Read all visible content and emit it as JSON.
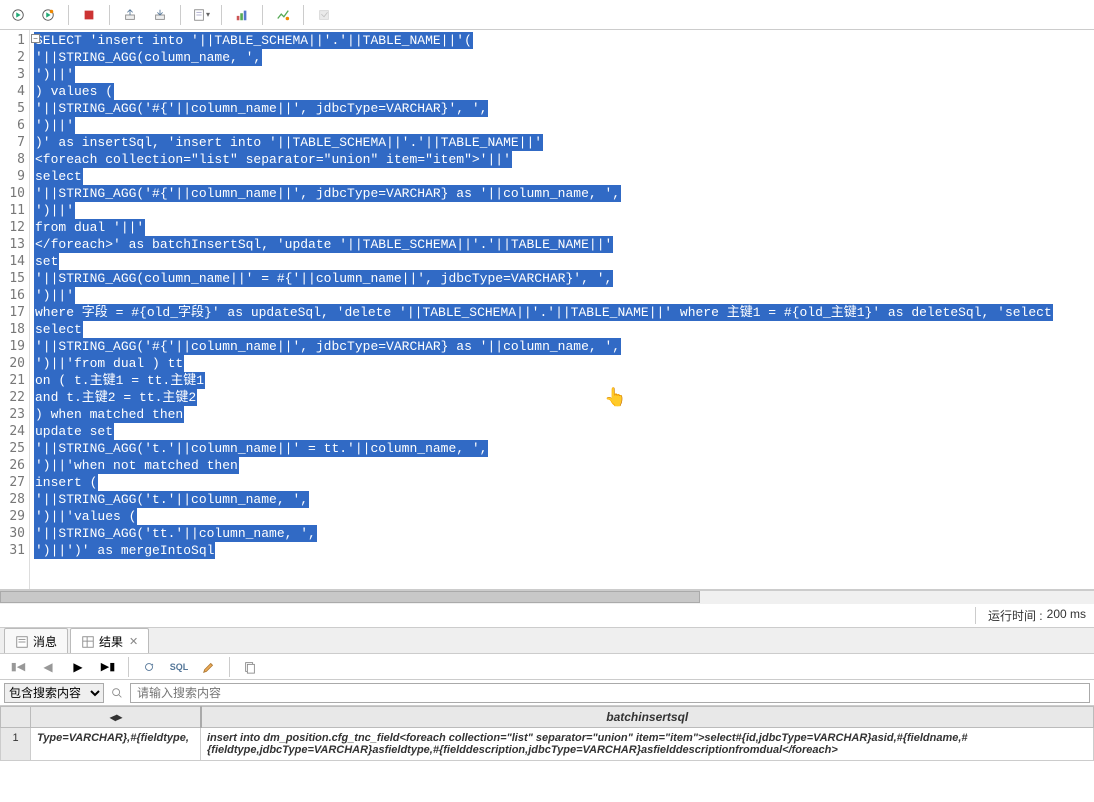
{
  "toolbar": {
    "icons": [
      "execute",
      "execute-new",
      "stop",
      "export",
      "import",
      "script",
      "dropdown",
      "chart",
      "analyze",
      "lock"
    ]
  },
  "editor": {
    "start_line": 1,
    "lines": [
      {
        "t": "SELECT 'insert into '||TABLE_SCHEMA||'.'||TABLE_NAME||'(",
        "sel": true
      },
      {
        "t": "'||STRING_AGG(column_name, ',",
        "sel": true
      },
      {
        "t": "')||'",
        "sel": true
      },
      {
        "t": ") values (",
        "sel": true
      },
      {
        "t": "'||STRING_AGG('#{'||column_name||', jdbcType=VARCHAR}', ',",
        "sel": true
      },
      {
        "t": "')||'",
        "sel": true
      },
      {
        "t": ")' as insertSql, 'insert into '||TABLE_SCHEMA||'.'||TABLE_NAME||'",
        "sel": true
      },
      {
        "t": "<foreach collection=\"list\" separator=\"union\" item=\"item\">'||'",
        "sel": true
      },
      {
        "t": "select",
        "sel": true
      },
      {
        "t": "'||STRING_AGG('#{'||column_name||', jdbcType=VARCHAR} as '||column_name, ',",
        "sel": true
      },
      {
        "t": "')||'",
        "sel": true
      },
      {
        "t": "from dual '||'",
        "sel": true
      },
      {
        "t": "</foreach>' as batchInsertSql, 'update '||TABLE_SCHEMA||'.'||TABLE_NAME||'",
        "sel": true
      },
      {
        "t": "set",
        "sel": true
      },
      {
        "t": "'||STRING_AGG(column_name||' = #{'||column_name||', jdbcType=VARCHAR}', ',",
        "sel": true
      },
      {
        "t": "')||'",
        "sel": true
      },
      {
        "t": "where 字段 = #{old_字段}' as updateSql, 'delete '||TABLE_SCHEMA||'.'||TABLE_NAME||' where 主键1 = #{old_主键1}' as deleteSql, 'select",
        "sel": true
      },
      {
        "t": "select",
        "sel": true
      },
      {
        "t": "'||STRING_AGG('#{'||column_name||', jdbcType=VARCHAR} as '||column_name, ',",
        "sel": true
      },
      {
        "t1": "')||'from dual ) tt",
        "sel": true,
        "t2": ""
      },
      {
        "t": "on ( t.主键1 = tt.主键1",
        "sel": true
      },
      {
        "t": "and t.主键2 = tt.主键2",
        "sel": true
      },
      {
        "t": ") when matched then",
        "sel": true
      },
      {
        "t": "update set",
        "sel": true
      },
      {
        "t": "'||STRING_AGG('t.'||column_name||' = tt.'||column_name, ',",
        "sel": true
      },
      {
        "t": "')||'when not matched then",
        "sel": true
      },
      {
        "t": "insert (",
        "sel": true
      },
      {
        "t": "'||STRING_AGG('t.'||column_name, ',",
        "sel": true
      },
      {
        "t": "')||'values (",
        "sel": true
      },
      {
        "t": "'||STRING_AGG('tt.'||column_name, ',",
        "sel": true
      },
      {
        "t": "')||')' as mergeIntoSql",
        "sel": true
      }
    ]
  },
  "status": {
    "runtime_label": "运行时间 :",
    "runtime_value": "200 ms"
  },
  "tabs": {
    "msg": "消息",
    "result": "结果"
  },
  "search": {
    "mode": "包含搜索内容",
    "placeholder": "请输入搜索内容"
  },
  "grid": {
    "header_col2": "batchinsertsql",
    "row1_num": "1",
    "row1_col1": "Type=VARCHAR},#{fieldtype,",
    "row1_col2": "insert into dm_position.cfg_tnc_field<foreach collection=\"list\" separator=\"union\" item=\"item\">select#{id,jdbcType=VARCHAR}asid,#{fieldname,#{fieldtype,jdbcType=VARCHAR}asfieldtype,#{fielddescription,jdbcType=VARCHAR}asfielddescriptionfromdual</foreach>"
  }
}
